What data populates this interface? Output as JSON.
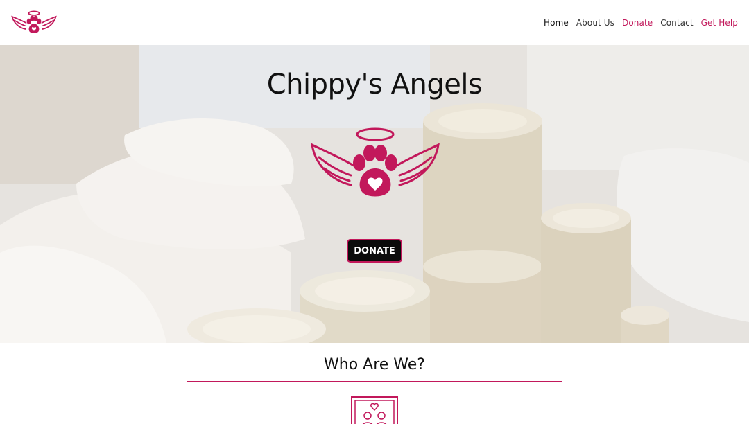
{
  "header": {
    "logo_icon": "angel-paw-icon",
    "nav": [
      {
        "label": "Home",
        "state": "current"
      },
      {
        "label": "About Us",
        "state": "normal"
      },
      {
        "label": "Donate",
        "state": "accent"
      },
      {
        "label": "Contact",
        "state": "normal"
      },
      {
        "label": "Get Help",
        "state": "accent"
      }
    ]
  },
  "hero": {
    "title": "Chippy's Angels",
    "logo_icon": "angel-paw-heart-icon",
    "background": "photo of canned food and bagged supplies",
    "donate_label": "DONATE"
  },
  "about": {
    "title": "Who Are We?",
    "icon": "framed-family-heart-icon"
  },
  "colors": {
    "accent": "#c2185b",
    "button_bg": "#0b0b0b",
    "button_text": "#ffffff"
  }
}
